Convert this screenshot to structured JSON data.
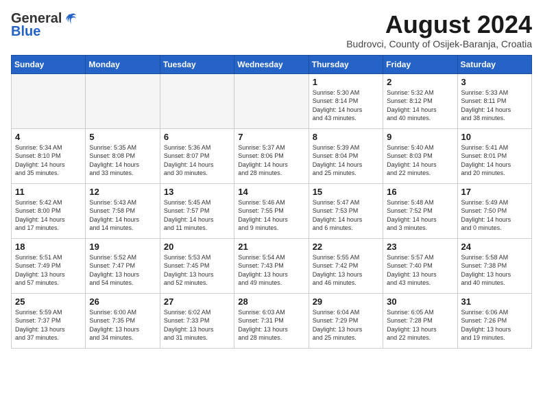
{
  "header": {
    "logo_general": "General",
    "logo_blue": "Blue",
    "title": "August 2024",
    "subtitle": "Budrovci, County of Osijek-Baranja, Croatia"
  },
  "days_of_week": [
    "Sunday",
    "Monday",
    "Tuesday",
    "Wednesday",
    "Thursday",
    "Friday",
    "Saturday"
  ],
  "weeks": [
    [
      {
        "day": "",
        "info": "",
        "empty": true
      },
      {
        "day": "",
        "info": "",
        "empty": true
      },
      {
        "day": "",
        "info": "",
        "empty": true
      },
      {
        "day": "",
        "info": "",
        "empty": true
      },
      {
        "day": "1",
        "info": "Sunrise: 5:30 AM\nSunset: 8:14 PM\nDaylight: 14 hours\nand 43 minutes.",
        "empty": false
      },
      {
        "day": "2",
        "info": "Sunrise: 5:32 AM\nSunset: 8:12 PM\nDaylight: 14 hours\nand 40 minutes.",
        "empty": false
      },
      {
        "day": "3",
        "info": "Sunrise: 5:33 AM\nSunset: 8:11 PM\nDaylight: 14 hours\nand 38 minutes.",
        "empty": false
      }
    ],
    [
      {
        "day": "4",
        "info": "Sunrise: 5:34 AM\nSunset: 8:10 PM\nDaylight: 14 hours\nand 35 minutes.",
        "empty": false
      },
      {
        "day": "5",
        "info": "Sunrise: 5:35 AM\nSunset: 8:08 PM\nDaylight: 14 hours\nand 33 minutes.",
        "empty": false
      },
      {
        "day": "6",
        "info": "Sunrise: 5:36 AM\nSunset: 8:07 PM\nDaylight: 14 hours\nand 30 minutes.",
        "empty": false
      },
      {
        "day": "7",
        "info": "Sunrise: 5:37 AM\nSunset: 8:06 PM\nDaylight: 14 hours\nand 28 minutes.",
        "empty": false
      },
      {
        "day": "8",
        "info": "Sunrise: 5:39 AM\nSunset: 8:04 PM\nDaylight: 14 hours\nand 25 minutes.",
        "empty": false
      },
      {
        "day": "9",
        "info": "Sunrise: 5:40 AM\nSunset: 8:03 PM\nDaylight: 14 hours\nand 22 minutes.",
        "empty": false
      },
      {
        "day": "10",
        "info": "Sunrise: 5:41 AM\nSunset: 8:01 PM\nDaylight: 14 hours\nand 20 minutes.",
        "empty": false
      }
    ],
    [
      {
        "day": "11",
        "info": "Sunrise: 5:42 AM\nSunset: 8:00 PM\nDaylight: 14 hours\nand 17 minutes.",
        "empty": false
      },
      {
        "day": "12",
        "info": "Sunrise: 5:43 AM\nSunset: 7:58 PM\nDaylight: 14 hours\nand 14 minutes.",
        "empty": false
      },
      {
        "day": "13",
        "info": "Sunrise: 5:45 AM\nSunset: 7:57 PM\nDaylight: 14 hours\nand 11 minutes.",
        "empty": false
      },
      {
        "day": "14",
        "info": "Sunrise: 5:46 AM\nSunset: 7:55 PM\nDaylight: 14 hours\nand 9 minutes.",
        "empty": false
      },
      {
        "day": "15",
        "info": "Sunrise: 5:47 AM\nSunset: 7:53 PM\nDaylight: 14 hours\nand 6 minutes.",
        "empty": false
      },
      {
        "day": "16",
        "info": "Sunrise: 5:48 AM\nSunset: 7:52 PM\nDaylight: 14 hours\nand 3 minutes.",
        "empty": false
      },
      {
        "day": "17",
        "info": "Sunrise: 5:49 AM\nSunset: 7:50 PM\nDaylight: 14 hours\nand 0 minutes.",
        "empty": false
      }
    ],
    [
      {
        "day": "18",
        "info": "Sunrise: 5:51 AM\nSunset: 7:49 PM\nDaylight: 13 hours\nand 57 minutes.",
        "empty": false
      },
      {
        "day": "19",
        "info": "Sunrise: 5:52 AM\nSunset: 7:47 PM\nDaylight: 13 hours\nand 54 minutes.",
        "empty": false
      },
      {
        "day": "20",
        "info": "Sunrise: 5:53 AM\nSunset: 7:45 PM\nDaylight: 13 hours\nand 52 minutes.",
        "empty": false
      },
      {
        "day": "21",
        "info": "Sunrise: 5:54 AM\nSunset: 7:43 PM\nDaylight: 13 hours\nand 49 minutes.",
        "empty": false
      },
      {
        "day": "22",
        "info": "Sunrise: 5:55 AM\nSunset: 7:42 PM\nDaylight: 13 hours\nand 46 minutes.",
        "empty": false
      },
      {
        "day": "23",
        "info": "Sunrise: 5:57 AM\nSunset: 7:40 PM\nDaylight: 13 hours\nand 43 minutes.",
        "empty": false
      },
      {
        "day": "24",
        "info": "Sunrise: 5:58 AM\nSunset: 7:38 PM\nDaylight: 13 hours\nand 40 minutes.",
        "empty": false
      }
    ],
    [
      {
        "day": "25",
        "info": "Sunrise: 5:59 AM\nSunset: 7:37 PM\nDaylight: 13 hours\nand 37 minutes.",
        "empty": false
      },
      {
        "day": "26",
        "info": "Sunrise: 6:00 AM\nSunset: 7:35 PM\nDaylight: 13 hours\nand 34 minutes.",
        "empty": false
      },
      {
        "day": "27",
        "info": "Sunrise: 6:02 AM\nSunset: 7:33 PM\nDaylight: 13 hours\nand 31 minutes.",
        "empty": false
      },
      {
        "day": "28",
        "info": "Sunrise: 6:03 AM\nSunset: 7:31 PM\nDaylight: 13 hours\nand 28 minutes.",
        "empty": false
      },
      {
        "day": "29",
        "info": "Sunrise: 6:04 AM\nSunset: 7:29 PM\nDaylight: 13 hours\nand 25 minutes.",
        "empty": false
      },
      {
        "day": "30",
        "info": "Sunrise: 6:05 AM\nSunset: 7:28 PM\nDaylight: 13 hours\nand 22 minutes.",
        "empty": false
      },
      {
        "day": "31",
        "info": "Sunrise: 6:06 AM\nSunset: 7:26 PM\nDaylight: 13 hours\nand 19 minutes.",
        "empty": false
      }
    ]
  ]
}
